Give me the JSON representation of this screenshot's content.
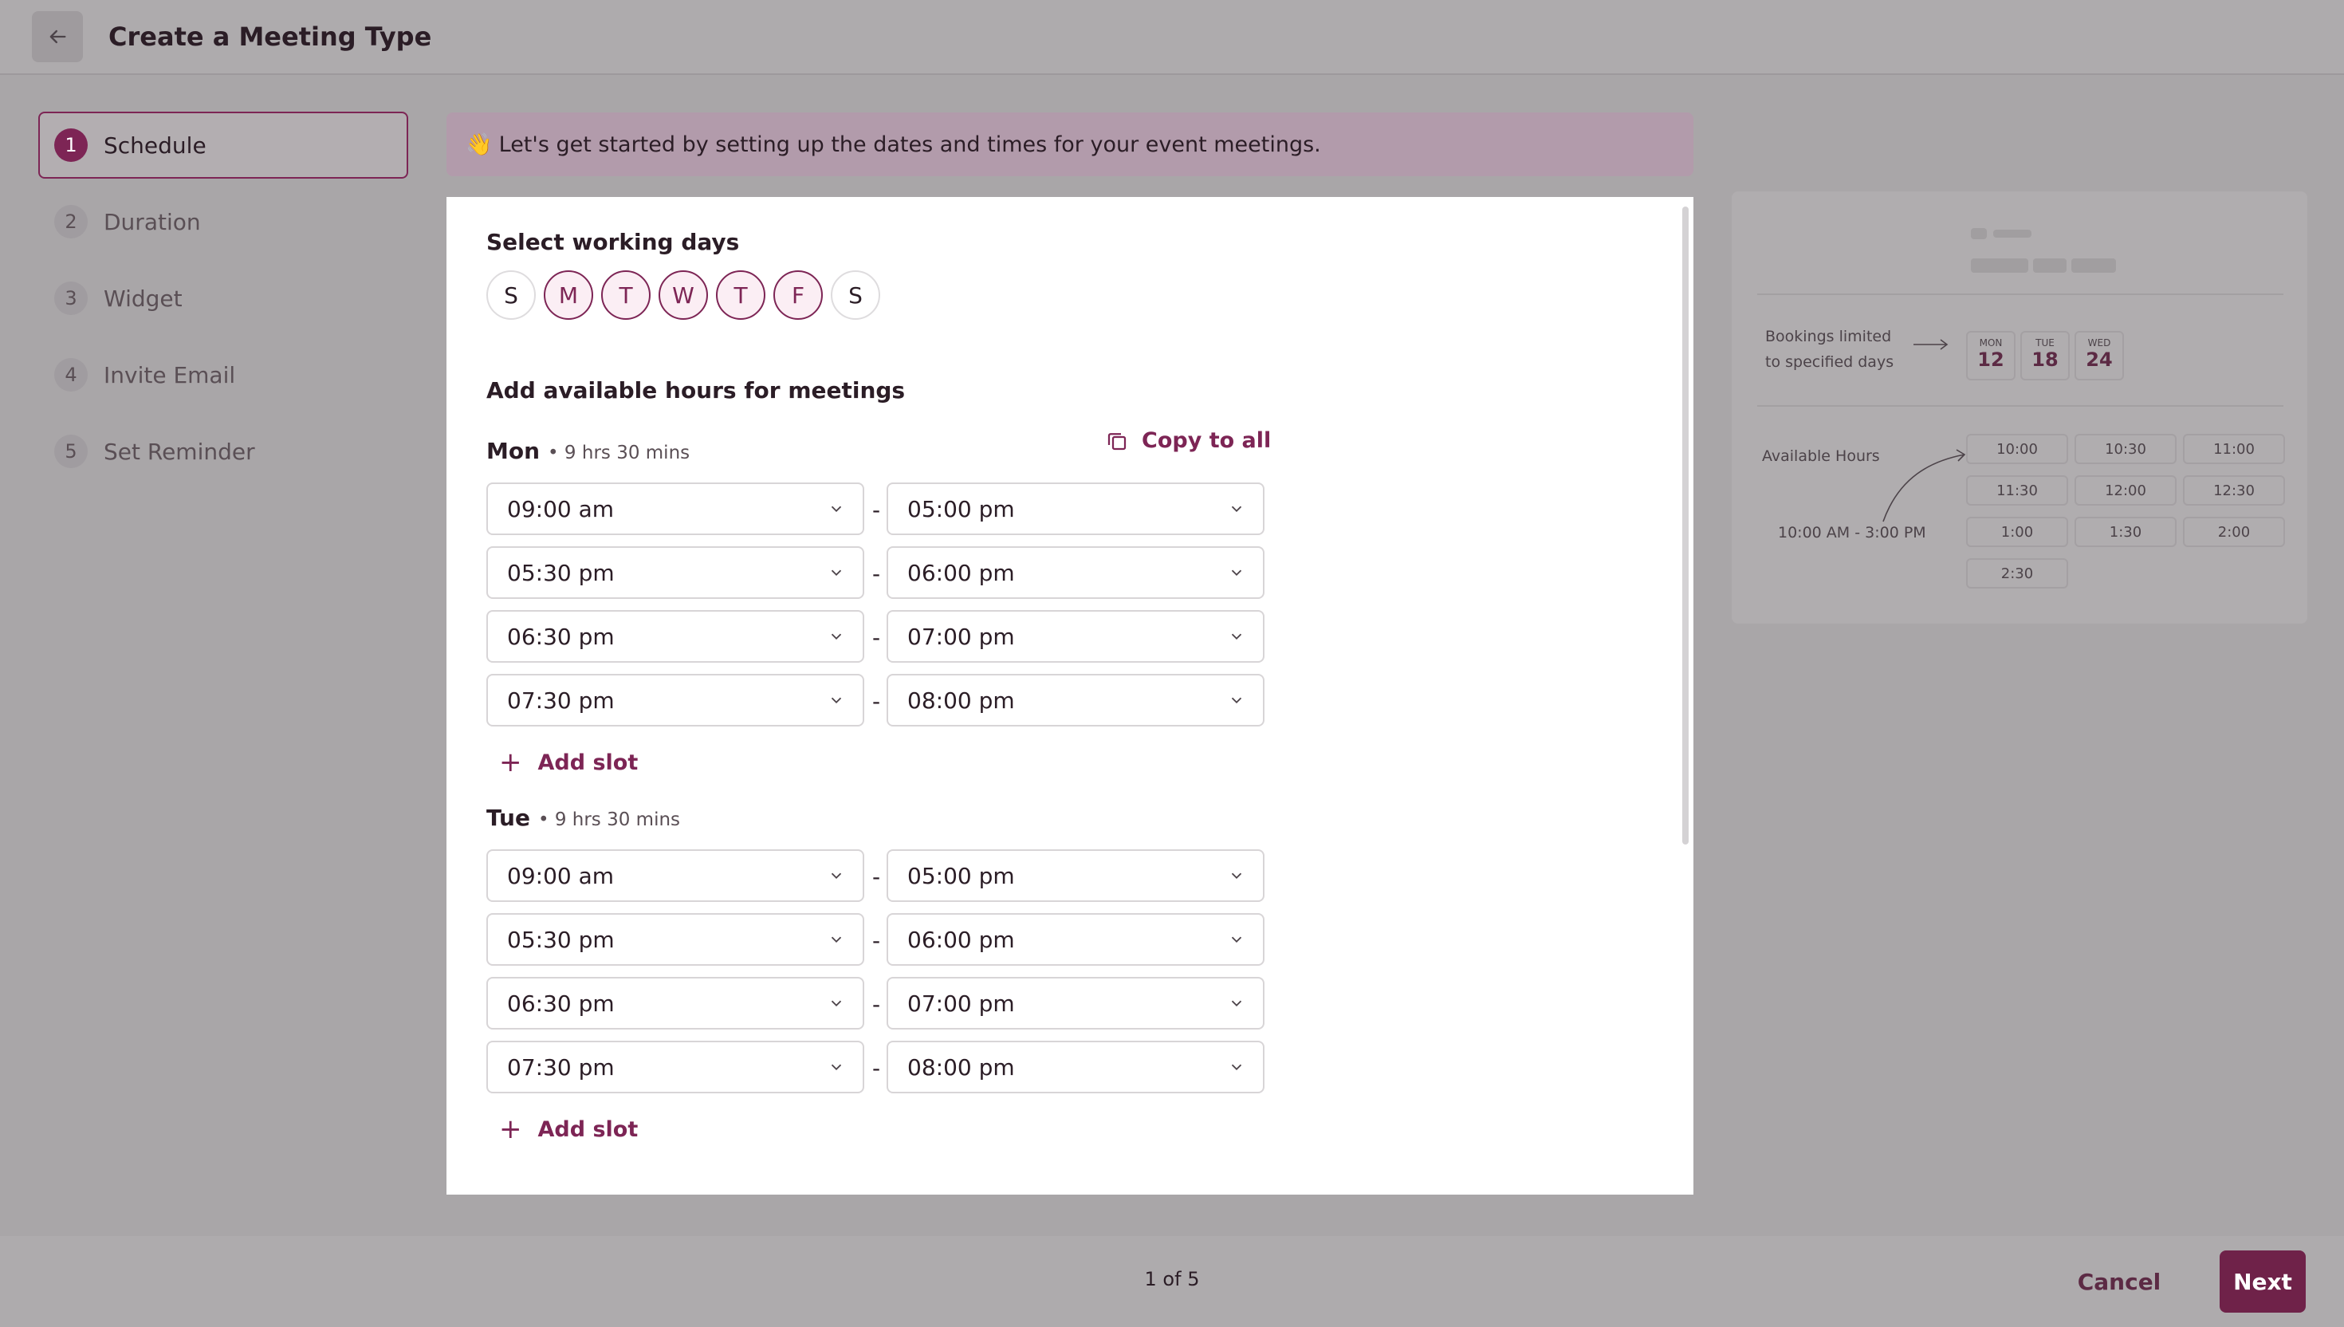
{
  "header": {
    "title": "Create a Meeting Type",
    "back_icon": "arrow-left-icon"
  },
  "steps": [
    {
      "num": "1",
      "label": "Schedule",
      "active": true
    },
    {
      "num": "2",
      "label": "Duration",
      "active": false
    },
    {
      "num": "3",
      "label": "Widget",
      "active": false
    },
    {
      "num": "4",
      "label": "Invite Email",
      "active": false
    },
    {
      "num": "5",
      "label": "Set Reminder",
      "active": false
    }
  ],
  "banner": {
    "emoji": "👋",
    "text": "Let's get started by setting up the dates and times for your event meetings."
  },
  "schedule": {
    "working_days_title": "Select working days",
    "days": [
      {
        "label": "S",
        "selected": false
      },
      {
        "label": "M",
        "selected": true
      },
      {
        "label": "T",
        "selected": true
      },
      {
        "label": "W",
        "selected": true
      },
      {
        "label": "T",
        "selected": true
      },
      {
        "label": "F",
        "selected": true
      },
      {
        "label": "S",
        "selected": false
      }
    ],
    "hours_title": "Add available hours for meetings",
    "copy_to_all": "Copy to all",
    "add_slot": "Add slot",
    "separator": "-",
    "day_blocks": [
      {
        "name": "Mon",
        "duration": "• 9 hrs 30 mins",
        "slots": [
          {
            "start": "09:00 am",
            "end": "05:00 pm"
          },
          {
            "start": "05:30 pm",
            "end": "06:00 pm"
          },
          {
            "start": "06:30 pm",
            "end": "07:00 pm"
          },
          {
            "start": "07:30 pm",
            "end": "08:00 pm"
          }
        ]
      },
      {
        "name": "Tue",
        "duration": "• 9 hrs 30 mins",
        "slots": [
          {
            "start": "09:00 am",
            "end": "05:00 pm"
          },
          {
            "start": "05:30 pm",
            "end": "06:00 pm"
          },
          {
            "start": "06:30 pm",
            "end": "07:00 pm"
          },
          {
            "start": "07:30 pm",
            "end": "08:00 pm"
          }
        ]
      }
    ]
  },
  "preview": {
    "bookings_limited": "Bookings limited to specified days",
    "dates": [
      {
        "weekday": "MON",
        "day": "12"
      },
      {
        "weekday": "TUE",
        "day": "18"
      },
      {
        "weekday": "WED",
        "day": "24"
      }
    ],
    "available_hours_label": "Available Hours",
    "range": "10:00 AM - 3:00 PM",
    "hours": [
      "10:00",
      "10:30",
      "11:00",
      "11:30",
      "12:00",
      "12:30",
      "1:00",
      "1:30",
      "2:00",
      "2:30"
    ]
  },
  "footer": {
    "pager": "1 of 5",
    "cancel": "Cancel",
    "next": "Next"
  },
  "colors": {
    "accent": "#7d2555",
    "accent_light": "#fbeef4",
    "overlay": "#a9a6a8"
  }
}
